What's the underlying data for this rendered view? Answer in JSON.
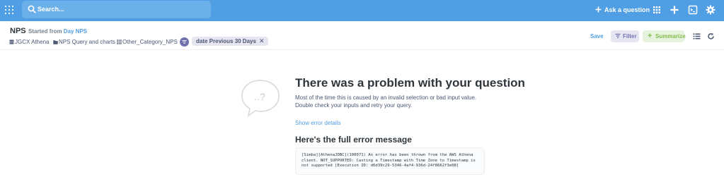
{
  "nav": {
    "search_placeholder": "Search...",
    "ask_label": "Ask a question",
    "icons": [
      "logo-icon",
      "search-icon",
      "apps-grid-icon",
      "plus-icon",
      "snippet-icon",
      "gear-icon"
    ],
    "color": "#509ee3"
  },
  "question": {
    "title": "NPS",
    "started_prefix": "Started from",
    "started_link": "Day NPS",
    "breadcrumbs": [
      {
        "label": "JGCX Athena",
        "icon": "database-icon"
      },
      {
        "label": "NPS Query and charts",
        "icon": "folder-icon"
      },
      {
        "label": "Other_Category_NPS",
        "icon": "table-icon"
      }
    ],
    "filter_pill": "date Previous 30 Days",
    "save_label": "Save",
    "filter_label": "Filter",
    "summarize_label": "Summarize"
  },
  "error": {
    "title": "There was a problem with your question",
    "body": "Most of the time this is caused by an invalid selection or bad input value. Double check your inputs and retry your query.",
    "details_link": "Show error details",
    "subtitle": "Here's the full error message",
    "message": "[Simba][AthenaJDBC](100071) An error has been thrown from the AWS Athena client. NOT_SUPPORTED: Casting a Timestamp with Time Zone to Timestamp is not supported [Execution ID: d6d39c29-5346-4af4-936d-24f8662f3e08]"
  }
}
